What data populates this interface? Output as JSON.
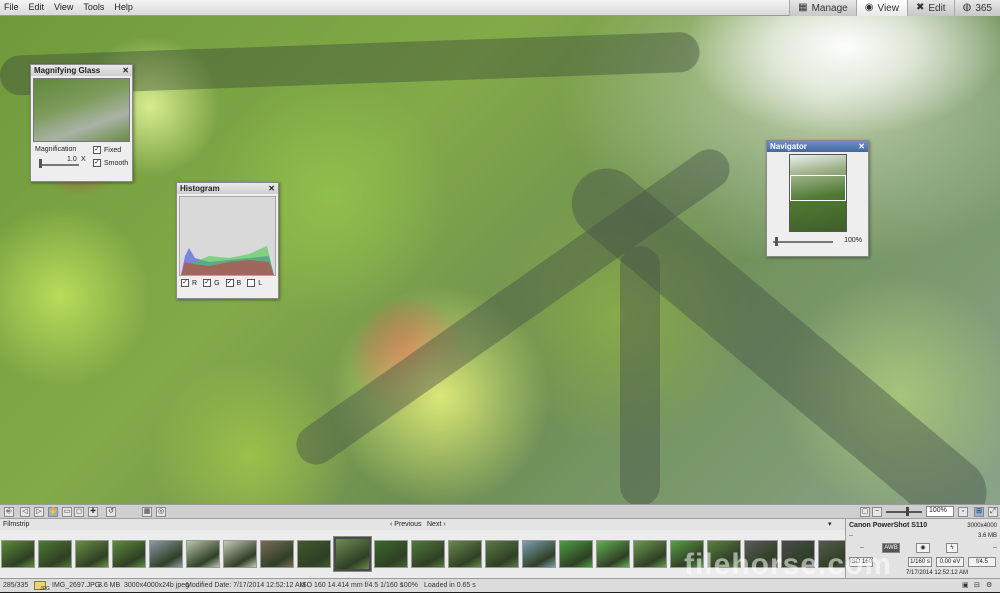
{
  "menu": {
    "items": [
      "File",
      "Edit",
      "View",
      "Tools",
      "Help"
    ]
  },
  "modes": [
    {
      "label": "Manage",
      "icon": "grid-icon",
      "active": false
    },
    {
      "label": "View",
      "icon": "eye-icon",
      "active": true
    },
    {
      "label": "Edit",
      "icon": "tools-icon",
      "active": false
    },
    {
      "label": "365",
      "icon": "cloud-365-icon",
      "active": false
    }
  ],
  "magnifier": {
    "title": "Magnifying Glass",
    "magnification_label": "Magnification",
    "magnification_value": "1.0",
    "magnification_unit": "X",
    "fixed_label": "Fixed",
    "smooth_label": "Smooth",
    "fixed_checked": true,
    "smooth_checked": true
  },
  "histogram": {
    "title": "Histogram",
    "channels": [
      "R",
      "G",
      "B",
      "L"
    ],
    "checked": [
      true,
      true,
      true,
      false
    ]
  },
  "navigator": {
    "title": "Navigator",
    "zoom": "100%"
  },
  "toolbar": {
    "zoom": "100%"
  },
  "filmstrip": {
    "label": "Filmstrip",
    "previous": "Previous",
    "next": "Next"
  },
  "thumb_colors": [
    "#5d8a3a",
    "#4d7a33",
    "#6a9040",
    "#5b8d3c",
    "#8a9aa8",
    "#b8c6a8",
    "#c2c9b8",
    "#7a6a55",
    "#3f5a2a",
    "#6d8c54",
    "#3a6a2a",
    "#4f7a3a",
    "#6a8a4a",
    "#5a7a45",
    "#7aa0b0",
    "#4aa040",
    "#62b050",
    "#6a9a50",
    "#5aa045",
    "#5a8040",
    "#5a5a5a",
    "#4a4a4a",
    "#555a50"
  ],
  "selected_index": 9,
  "info": {
    "camera": "Canon PowerShot S110",
    "dimensions": "3000x4000",
    "size": "3.6 MB",
    "iso": "ISO 160",
    "awb": "AWB",
    "shutter": "1/160 s",
    "ev": "0.00 eV",
    "aperture": "f/4.5",
    "date": "7/17/2014 12:52:12 AM",
    "dash": "--"
  },
  "status": {
    "count": "285/335",
    "type": "JPG",
    "filename": "IMG_2697.JPG",
    "filesize": "3.6 MB",
    "imageinfo": "3000x4000x24b jpeg",
    "modified": "Modified Date: 7/17/2014 12:52:12 AM",
    "exif": "ISO 160    14.414 mm    f/4.5    1/160 s",
    "zoom": "100%",
    "loaded": "Loaded in 0.65 s"
  },
  "watermark": "filehorse.com"
}
